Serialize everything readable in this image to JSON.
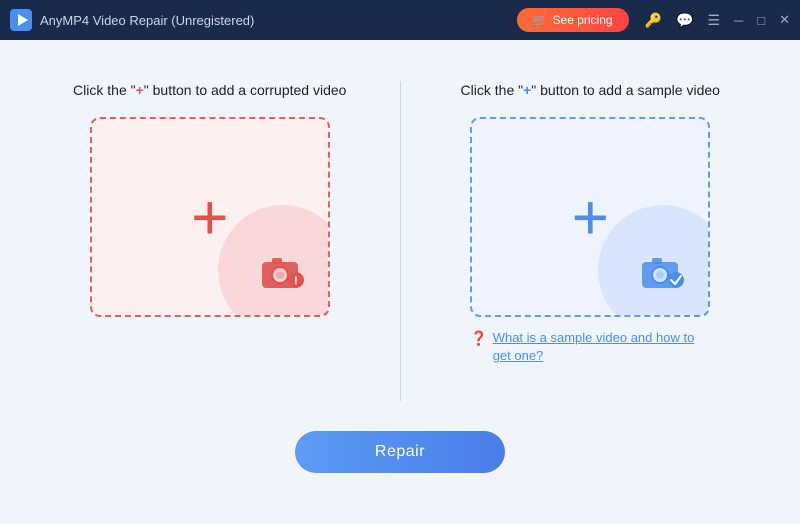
{
  "titlebar": {
    "title": "AnyMP4 Video Repair (Unregistered)",
    "see_pricing_label": "See pricing",
    "logo_color": "#4a8fef"
  },
  "panels": {
    "left": {
      "instruction_prefix": "Click the \"",
      "plus": "+",
      "instruction_suffix": "\" button to add a corrupted video"
    },
    "right": {
      "instruction_prefix": "Click the \"",
      "plus": "+",
      "instruction_suffix": "\" button to add a sample video",
      "help_link": "What is a sample video and how to get one?"
    }
  },
  "repair_button_label": "Repair"
}
